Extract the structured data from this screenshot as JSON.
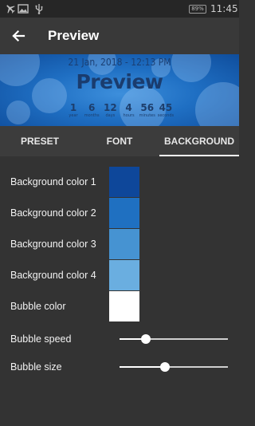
{
  "status_bar": {
    "icons": [
      "airplane-icon",
      "image-icon",
      "usb-icon"
    ],
    "battery": "89%",
    "time": "11:45"
  },
  "app_bar": {
    "back_icon": "arrow-left-icon",
    "title": "Preview"
  },
  "preview": {
    "date": "21 Jan, 2018 - 12:13 PM",
    "title": "Preview",
    "countdown": [
      {
        "value": "1",
        "unit": "year"
      },
      {
        "value": "6",
        "unit": "months"
      },
      {
        "value": "12",
        "unit": "days"
      },
      {
        "value": "4",
        "unit": "hours"
      },
      {
        "value": "56",
        "unit": "minutes"
      },
      {
        "value": "45",
        "unit": "seconds"
      }
    ]
  },
  "tabs": [
    {
      "label": "PRESET"
    },
    {
      "label": "FONT"
    },
    {
      "label": "BACKGROUND"
    }
  ],
  "active_tab": "BACKGROUND",
  "settings": {
    "colors": [
      {
        "label": "Background color 1",
        "color": "#0e479a"
      },
      {
        "label": "Background color 2",
        "color": "#1f70c1"
      },
      {
        "label": "Background color 3",
        "color": "#4693d2"
      },
      {
        "label": "Background color 4",
        "color": "#6aaee0"
      },
      {
        "label": "Bubble color",
        "color": "#ffffff"
      }
    ],
    "sliders": [
      {
        "label": "Bubble speed",
        "value_fraction": 0.24
      },
      {
        "label": "Bubble size",
        "value_fraction": 0.42
      }
    ]
  }
}
